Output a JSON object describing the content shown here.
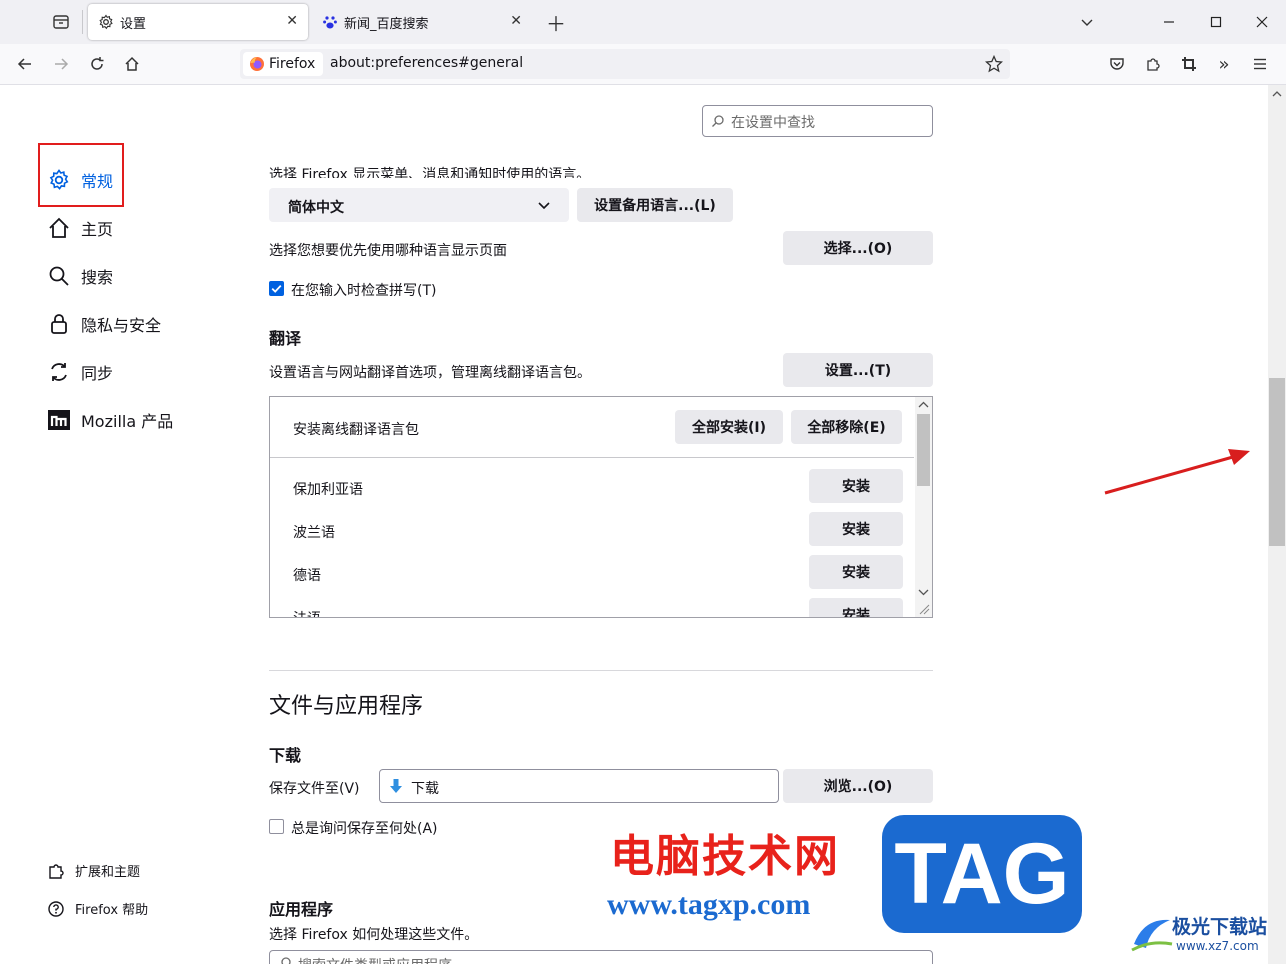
{
  "tabs": [
    {
      "label": "设置",
      "active": true
    },
    {
      "label": "新闻_百度搜索",
      "active": false
    }
  ],
  "nav": {
    "identity_label": "Firefox",
    "url": "about:preferences#general"
  },
  "search": {
    "placeholder": "在设置中查找"
  },
  "sidebar": {
    "categories": [
      {
        "label": "常规"
      },
      {
        "label": "主页"
      },
      {
        "label": "搜索"
      },
      {
        "label": "隐私与安全"
      },
      {
        "label": "同步"
      },
      {
        "label": "Mozilla 产品"
      }
    ],
    "footer": [
      {
        "label": "扩展和主题"
      },
      {
        "label": "Firefox 帮助"
      }
    ]
  },
  "language": {
    "desc_cut": "选择 Firefox 显示菜单、消息和通知时使用的语言。",
    "selected": "简体中文",
    "alt_button": "设置备用语言...(L)",
    "page_lang_label": "选择您想要优先使用哪种语言显示页面",
    "choose_button": "选择...(O)",
    "spellcheck_label": "在您输入时检查拼写(T)",
    "spellcheck_checked": true
  },
  "translate": {
    "heading": "翻译",
    "desc": "设置语言与网站翻译首选项，管理离线翻译语言包。",
    "settings_button": "设置...(T)",
    "box_title": "安装离线翻译语言包",
    "install_all": "全部安装(I)",
    "remove_all": "全部移除(E)",
    "languages": [
      {
        "name": "保加利亚语",
        "action": "安装"
      },
      {
        "name": "波兰语",
        "action": "安装"
      },
      {
        "name": "德语",
        "action": "安装"
      },
      {
        "name": "法语",
        "action": "安装"
      }
    ]
  },
  "files": {
    "section_title": "文件与应用程序",
    "download_heading": "下载",
    "save_to_label": "保存文件至(V)",
    "save_to_value": "下载",
    "browse_button": "浏览...(O)",
    "always_ask_label": "总是询问保存至何处(A)",
    "always_ask_checked": false,
    "apps_heading": "应用程序",
    "apps_desc": "选择 Firefox 如何处理这些文件。",
    "apps_search_placeholder": "搜索文件类型或应用程序"
  },
  "watermark": {
    "title": "电脑技术网",
    "url": "www.tagxp.com",
    "badge": "TAG",
    "site_name": "极光下载站",
    "site_url": "www.xz7.com"
  },
  "colors": {
    "accent": "#0061e0",
    "highlight_box": "#e11d1d",
    "arrow": "#d81e1e"
  }
}
